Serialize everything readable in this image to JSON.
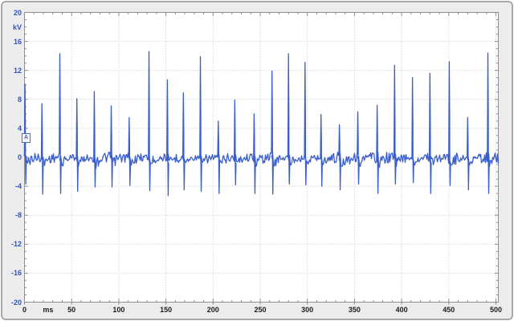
{
  "window": {
    "background_color": "#ececec",
    "frame_color": "#a9a9ad",
    "plot_background": "#ffffff",
    "plot_border_color": "#8f8f94"
  },
  "chart_data": {
    "type": "line",
    "title": "",
    "x_unit": "ms",
    "y_unit": "kV",
    "channel_marker": "A",
    "xlim": [
      0,
      503
    ],
    "ylim": [
      -20,
      20
    ],
    "x_ticks": [
      0,
      50,
      100,
      150,
      200,
      250,
      300,
      350,
      400,
      450,
      500
    ],
    "x_minor_tick_step": 10,
    "y_ticks": [
      20,
      16,
      12,
      8,
      4,
      0,
      -4,
      -8,
      -12,
      -16,
      -20
    ],
    "y_minor_tick_step": 1,
    "grid": "dotted major grid every 50 ms and 4 kV",
    "legend_position": "none",
    "trace_color": "#3a5ec9",
    "grid_color": "#c8c8cc",
    "tick_color": "#8c8c90",
    "y_label_color": "#2e53c6",
    "x_label_color": "#1c1c1e",
    "baseline_kv": 0,
    "noise_kv": 0.3,
    "description": "Impulse waveform: periodic bipolar spikes (~19 ms apart) on a noisy zero baseline",
    "spikes": [
      {
        "t": 0.5,
        "peak": 10.1,
        "trough": -3.7
      },
      {
        "t": 18.5,
        "peak": 7.4,
        "trough": -5.1
      },
      {
        "t": 37.5,
        "peak": 14.3,
        "trough": -5.0
      },
      {
        "t": 55.5,
        "peak": 8.1,
        "trough": -4.7
      },
      {
        "t": 74.0,
        "peak": 9.1,
        "trough": -4.1
      },
      {
        "t": 92.0,
        "peak": 7.1,
        "trough": -4.1
      },
      {
        "t": 111.0,
        "peak": 5.5,
        "trough": -3.9
      },
      {
        "t": 132.0,
        "peak": 14.6,
        "trough": -4.6
      },
      {
        "t": 151.5,
        "peak": 10.7,
        "trough": -5.3
      },
      {
        "t": 168.5,
        "peak": 8.9,
        "trough": -4.5
      },
      {
        "t": 186.5,
        "peak": 13.9,
        "trough": -4.7
      },
      {
        "t": 205.5,
        "peak": 5.0,
        "trough": -5.0
      },
      {
        "t": 223.0,
        "peak": 7.9,
        "trough": -3.8
      },
      {
        "t": 243.5,
        "peak": 6.0,
        "trough": -5.0
      },
      {
        "t": 262.5,
        "peak": 11.9,
        "trough": -5.1
      },
      {
        "t": 280.0,
        "peak": 14.3,
        "trough": -3.7
      },
      {
        "t": 297.5,
        "peak": 13.1,
        "trough": -3.8
      },
      {
        "t": 314.5,
        "peak": 5.9,
        "trough": -4.0
      },
      {
        "t": 334.0,
        "peak": 4.5,
        "trough": -4.5
      },
      {
        "t": 353.5,
        "peak": 6.3,
        "trough": -3.7
      },
      {
        "t": 374.0,
        "peak": 7.2,
        "trough": -5.0
      },
      {
        "t": 392.5,
        "peak": 12.7,
        "trough": -3.7
      },
      {
        "t": 411.5,
        "peak": 11.0,
        "trough": -3.5
      },
      {
        "t": 430.0,
        "peak": 11.6,
        "trough": -5.0
      },
      {
        "t": 450.5,
        "peak": 13.2,
        "trough": -3.9
      },
      {
        "t": 470.0,
        "peak": 5.5,
        "trough": -4.5
      },
      {
        "t": 491.5,
        "peak": 14.4,
        "trough": -5.0
      }
    ]
  }
}
